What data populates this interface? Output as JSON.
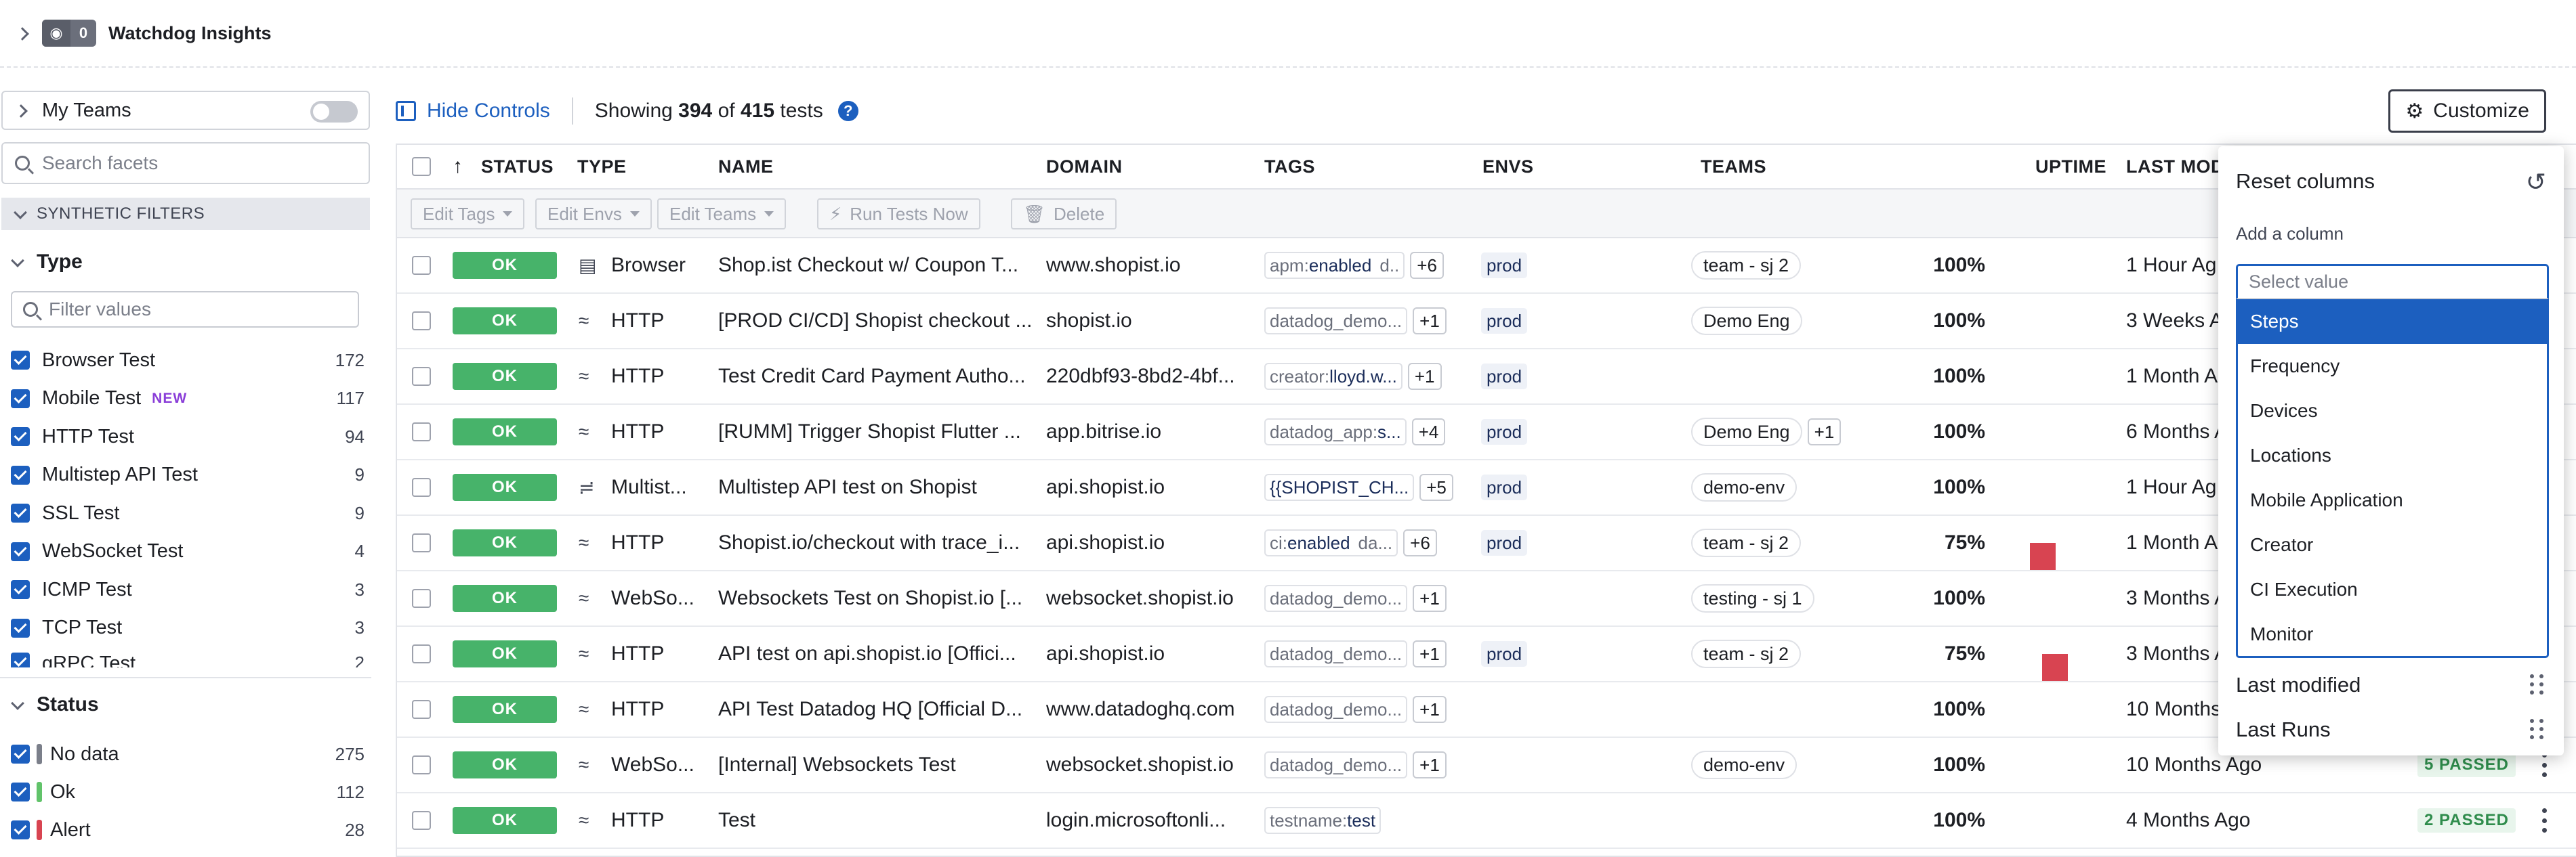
{
  "watchdog": {
    "count": "0",
    "title": "Watchdog Insights"
  },
  "sidebar": {
    "my_teams": "My Teams",
    "search_placeholder": "Search facets",
    "section": "SYNTHETIC FILTERS",
    "type_group": {
      "title": "Type",
      "filter_placeholder": "Filter values",
      "items": [
        {
          "name": "Browser Test",
          "count": "172",
          "badge": ""
        },
        {
          "name": "Mobile Test",
          "count": "117",
          "badge": "NEW"
        },
        {
          "name": "HTTP Test",
          "count": "94",
          "badge": ""
        },
        {
          "name": "Multistep API Test",
          "count": "9",
          "badge": ""
        },
        {
          "name": "SSL Test",
          "count": "9",
          "badge": ""
        },
        {
          "name": "WebSocket Test",
          "count": "4",
          "badge": ""
        },
        {
          "name": "ICMP Test",
          "count": "3",
          "badge": ""
        },
        {
          "name": "TCP Test",
          "count": "3",
          "badge": ""
        },
        {
          "name": "gRPC Test",
          "count": "2",
          "badge": ""
        }
      ]
    },
    "status_group": {
      "title": "Status",
      "items": [
        {
          "name": "No data",
          "count": "275",
          "color": "#7b7f8a"
        },
        {
          "name": "Ok",
          "count": "112",
          "color": "#61c36a"
        },
        {
          "name": "Alert",
          "count": "28",
          "color": "#d84451"
        }
      ]
    }
  },
  "toolbar": {
    "hide_controls": "Hide Controls",
    "showing_prefix": "Showing",
    "shown": "394",
    "of": "of",
    "total": "415",
    "suffix": "tests",
    "customize": "Customize"
  },
  "table": {
    "headers": {
      "status": "STATUS",
      "type": "TYPE",
      "name": "NAME",
      "domain": "DOMAIN",
      "tags": "TAGS",
      "envs": "ENVS",
      "teams": "TEAMS",
      "uptime": "UPTIME",
      "last_modified": "LAST MODI"
    },
    "bulk": {
      "edit_tags": "Edit Tags",
      "edit_envs": "Edit Envs",
      "edit_teams": "Edit Teams",
      "run_tests": "Run Tests Now",
      "delete": "Delete"
    },
    "rows": [
      {
        "status": "OK",
        "type_icon": "browser-icon",
        "type": "Browser",
        "name": "Shop.ist Checkout w/ Coupon T...",
        "domain": "www.shopist.io",
        "tag_k": "apm:",
        "tag_v": "enabled",
        "tag2": "d..",
        "more": "+6",
        "env": "prod",
        "team": "team - sj 2",
        "team_more": "",
        "uptime": "100%",
        "uptime_fraction": 1.0,
        "last": "1 Hour Ag",
        "passed": ""
      },
      {
        "status": "OK",
        "type_icon": "http-icon",
        "type": "HTTP",
        "name": "[PROD CI/CD] Shopist checkout ...",
        "domain": "shopist.io",
        "tag_k": "datadog_demo...",
        "tag_v": "",
        "tag2": "",
        "more": "+1",
        "env": "prod",
        "team": "Demo Eng",
        "team_more": "",
        "uptime": "100%",
        "uptime_fraction": 1.0,
        "last": "3 Weeks A",
        "passed": ""
      },
      {
        "status": "OK",
        "type_icon": "http-icon",
        "type": "HTTP",
        "name": "Test Credit Card Payment Autho...",
        "domain": "220dbf93-8bd2-4bf...",
        "tag_k": "creator:",
        "tag_v": "lloyd.w...",
        "tag2": "",
        "more": "+1",
        "env": "prod",
        "team": "",
        "team_more": "",
        "uptime": "100%",
        "uptime_fraction": 1.0,
        "last": "1 Month A",
        "passed": ""
      },
      {
        "status": "OK",
        "type_icon": "http-icon",
        "type": "HTTP",
        "name": "[RUMM] Trigger Shopist Flutter ...",
        "domain": "app.bitrise.io",
        "tag_k": "datadog_app:",
        "tag_v": "s...",
        "tag2": "",
        "more": "+4",
        "env": "prod",
        "team": "Demo Eng",
        "team_more": "+1",
        "uptime": "100%",
        "uptime_fraction": 1.0,
        "last": "6 Months A",
        "passed": ""
      },
      {
        "status": "OK",
        "type_icon": "multistep-icon",
        "type": "Multist...",
        "name": "Multistep API test on Shopist",
        "domain": "api.shopist.io",
        "tag_k": "",
        "tag_v": "{{SHOPIST_CH...",
        "tag2": "",
        "more": "+5",
        "env": "prod",
        "team": "demo-env",
        "team_more": "",
        "uptime": "100%",
        "uptime_fraction": 1.0,
        "last": "1 Hour Ag",
        "passed": ""
      },
      {
        "status": "OK",
        "type_icon": "http-icon",
        "type": "HTTP",
        "name": "Shopist.io/checkout with trace_i...",
        "domain": "api.shopist.io",
        "tag_k": "ci:",
        "tag_v": "enabled",
        "tag2": "da...",
        "more": "+6",
        "env": "prod",
        "team": "team - sj 2",
        "team_more": "",
        "uptime": "75%",
        "uptime_fraction": 0.75,
        "last": "1 Month A",
        "passed": ""
      },
      {
        "status": "OK",
        "type_icon": "websocket-icon",
        "type": "WebSo...",
        "name": "Websockets Test on Shopist.io [...",
        "domain": "websocket.shopist.io",
        "tag_k": "datadog_demo...",
        "tag_v": "",
        "tag2": "",
        "more": "+1",
        "env": "",
        "team": "testing - sj 1",
        "team_more": "",
        "uptime": "100%",
        "uptime_fraction": 1.0,
        "last": "3 Months A",
        "passed": ""
      },
      {
        "status": "OK",
        "type_icon": "http-icon",
        "type": "HTTP",
        "name": "API test on api.shopist.io [Offici...",
        "domain": "api.shopist.io",
        "tag_k": "datadog_demo...",
        "tag_v": "",
        "tag2": "",
        "more": "+1",
        "env": "prod",
        "team": "team - sj 2",
        "team_more": "",
        "uptime": "75%",
        "uptime_fraction": 0.75,
        "last": "3 Months A",
        "passed": ""
      },
      {
        "status": "OK",
        "type_icon": "http-icon",
        "type": "HTTP",
        "name": "API Test Datadog HQ [Official D...",
        "domain": "www.datadoghq.com",
        "tag_k": "datadog_demo...",
        "tag_v": "",
        "tag2": "",
        "more": "+1",
        "env": "",
        "team": "",
        "team_more": "",
        "uptime": "100%",
        "uptime_fraction": 1.0,
        "last": "10 Months",
        "passed": ""
      },
      {
        "status": "OK",
        "type_icon": "websocket-icon",
        "type": "WebSo...",
        "name": "[Internal] Websockets Test",
        "domain": "websocket.shopist.io",
        "tag_k": "datadog_demo...",
        "tag_v": "",
        "tag2": "",
        "more": "+1",
        "env": "",
        "team": "demo-env",
        "team_more": "",
        "uptime": "100%",
        "uptime_fraction": 1.0,
        "last": "10 Months Ago",
        "passed": "5 PASSED"
      },
      {
        "status": "OK",
        "type_icon": "http-icon",
        "type": "HTTP",
        "name": "Test",
        "domain": "login.microsoftonli...",
        "tag_k": "testname:",
        "tag_v": "test",
        "tag2": "",
        "more": "",
        "env": "",
        "team": "",
        "team_more": "",
        "uptime": "100%",
        "uptime_fraction": 1.0,
        "last": "4 Months Ago",
        "passed": "2 PASSED"
      }
    ]
  },
  "customize_panel": {
    "reset": "Reset columns",
    "add_column": "Add a column",
    "select_placeholder": "Select value",
    "options": [
      "Steps",
      "Frequency",
      "Devices",
      "Locations",
      "Mobile Application",
      "Creator",
      "CI Execution",
      "Monitor"
    ],
    "selected": "Steps",
    "columns": [
      "Last modified",
      "Last Runs"
    ]
  },
  "colors": {
    "accent": "#1c5fbf",
    "ok": "#47b36a",
    "uptime_green": "#61c36a",
    "uptime_red": "#d84451"
  }
}
